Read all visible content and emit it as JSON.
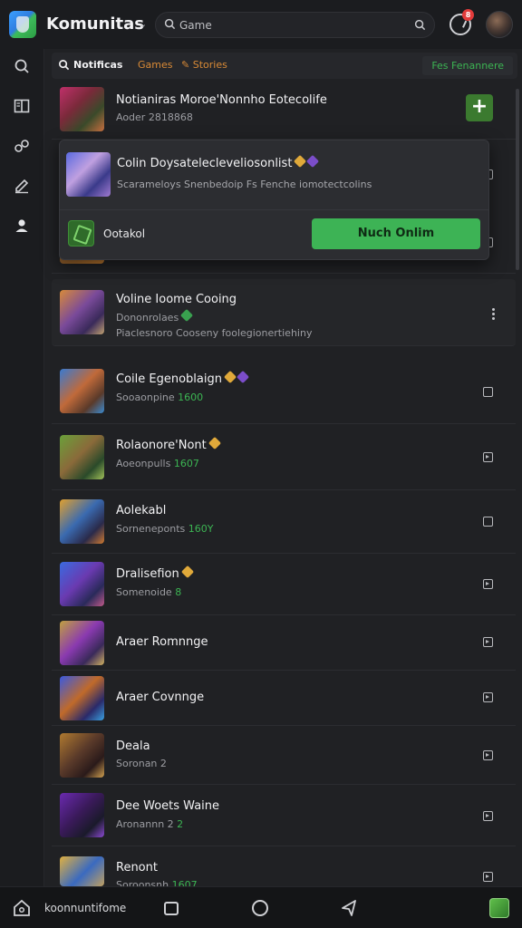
{
  "header": {
    "title": "Komunitas",
    "search_placeholder": "Game",
    "notification_count": "8"
  },
  "subnav": {
    "tabs": [
      {
        "label": "Notificas"
      },
      {
        "label": "Games"
      },
      {
        "label": "Stories"
      }
    ],
    "cta_label": "Fes Fenannere"
  },
  "popup": {
    "title": "Colin Doysatelecleveliosonlist",
    "subtitle": "Scarameloys Snenbedoip Fs Fenche iomotectcolins",
    "action_label": "Ootakol",
    "button_label": "Nuch Onlim"
  },
  "rows": [
    {
      "title": "Notianiras Moroe'Nonnho Eotecolife",
      "sub": "Aoder 2818868"
    },
    {
      "title": "Voline Ioome Cooing",
      "sub": "Dononrolaes",
      "extra": "Piaclesnoro Cooseny foolegionertiehiny"
    },
    {
      "title": "Coile Egenoblaign",
      "sub": "Sooaonpine",
      "price": "1600"
    },
    {
      "title": "Rolaonore'Nont",
      "sub": "Aoeonpulls",
      "price": "1607"
    },
    {
      "title": "Aolekabl",
      "sub": "Sorneneponts",
      "price": "160Y"
    },
    {
      "title": "Dralisefion",
      "sub": "Somenoide",
      "price": "8"
    },
    {
      "title": "Araer Romnnge"
    },
    {
      "title": "Araer Covnnge"
    },
    {
      "title": "Deala",
      "sub": "Soronan 2"
    },
    {
      "title": "Dee Woets Waine",
      "sub": "Aronannn 2",
      "price": "2"
    },
    {
      "title": "Renont",
      "sub": "Soroonsnh",
      "price": "1607"
    }
  ],
  "bottombar": {
    "label": "koonnuntifome"
  },
  "colors": {
    "accent_green": "#3db355",
    "accent_orange": "#d98a36",
    "badge_red": "#e23b3b",
    "background": "#202124"
  },
  "icons": {
    "sidebar": [
      "search-icon",
      "book-icon",
      "link-icon",
      "edit-icon",
      "user-icon"
    ]
  }
}
